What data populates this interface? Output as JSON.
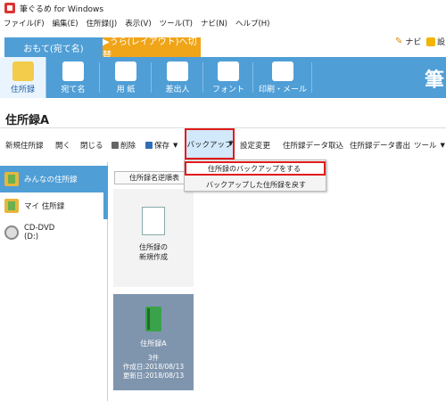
{
  "window": {
    "title": "筆ぐるめ for Windows"
  },
  "menu": [
    "ファイル(F)",
    "編集(E)",
    "住所録(J)",
    "表示(V)",
    "ツール(T)",
    "ナビ(N)",
    "ヘルプ(H)"
  ],
  "mode_tabs": {
    "front": "おもて(宛て名)",
    "back": "▶うら(レイアウト)へ切替"
  },
  "navi": {
    "label": "ナビ",
    "extra": "設"
  },
  "big_toolbar": [
    {
      "label": "住所録"
    },
    {
      "label": "宛て名"
    },
    {
      "label": "用 紙"
    },
    {
      "label": "差出人"
    },
    {
      "label": "フォント"
    },
    {
      "label": "印刷・メール"
    }
  ],
  "big_toolbar_logo": "筆",
  "header": {
    "title": "住所録A"
  },
  "commands": {
    "new": "新規住所録",
    "open": "開く",
    "close": "閉じる",
    "delete": "削除",
    "save": "保存",
    "backup": "バックアップ",
    "settings": "設定変更",
    "import": "住所録データ取込",
    "export": "住所録データ書出",
    "tools": "ツール"
  },
  "dropdown": {
    "items": [
      "住所録のバックアップをする",
      "バックアップした住所録を戻す"
    ]
  },
  "sidebar": {
    "items": [
      {
        "label": "みんなの住所録"
      },
      {
        "label": "マイ 住所録"
      },
      {
        "label": "CD-DVD",
        "sub": "(D:)"
      }
    ]
  },
  "sort_button": "住所録名逆順表",
  "cards": {
    "new": {
      "line1": "住所録の",
      "line2": "新規作成"
    },
    "selected": {
      "name": "住所録A",
      "count": "3件",
      "created": "作成日:2018/08/13",
      "updated": "更新日:2018/08/13"
    }
  }
}
